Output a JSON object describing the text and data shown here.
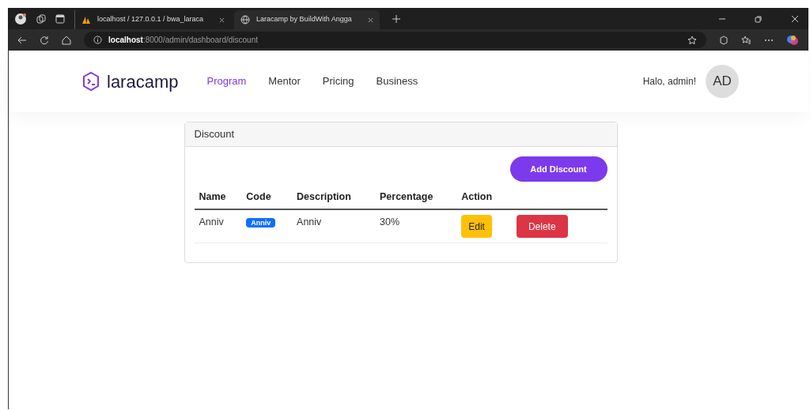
{
  "browser": {
    "tabs": [
      {
        "title": "localhost / 127.0.0.1 / bwa_laraca",
        "selected": false
      },
      {
        "title": "Laracamp by BuildWith Angga",
        "selected": true
      }
    ],
    "address": {
      "host": "localhost",
      "path": ":8000/admin/dashboard/discount"
    }
  },
  "navbar": {
    "brand": "laracamp",
    "links": [
      {
        "label": "Program",
        "selected": true
      },
      {
        "label": "Mentor",
        "selected": false
      },
      {
        "label": "Pricing",
        "selected": false
      },
      {
        "label": "Business",
        "selected": false
      }
    ],
    "greeting": "Halo, admin!",
    "avatar": "AD"
  },
  "card": {
    "title": "Discount",
    "add_button": "Add Discount",
    "table": {
      "columns": [
        "Name",
        "Code",
        "Description",
        "Percentage",
        "Action"
      ],
      "rows": [
        {
          "name": "Anniv",
          "code": "Anniv",
          "description": "Anniv",
          "percentage": "30%",
          "actions": [
            "Edit",
            "Delete"
          ]
        }
      ]
    }
  }
}
